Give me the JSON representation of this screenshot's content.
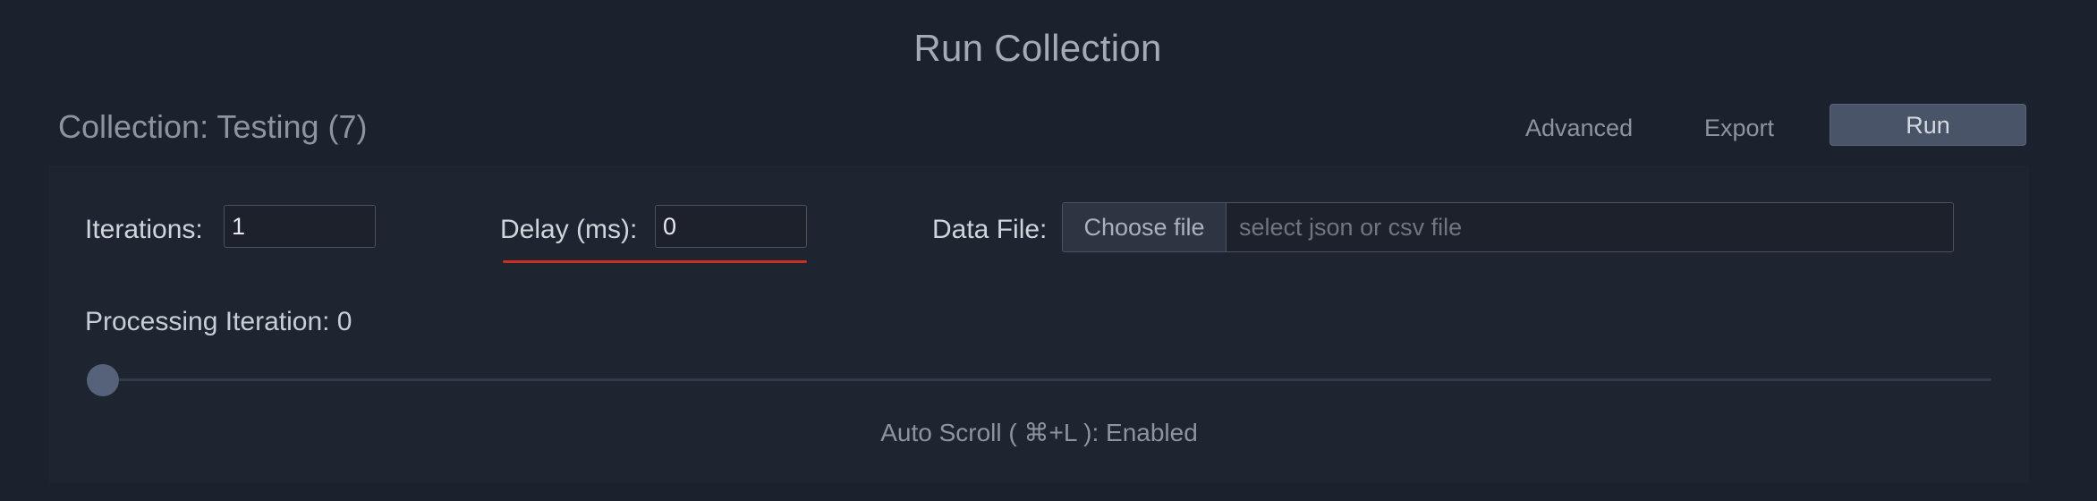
{
  "header": {
    "title": "Run Collection",
    "collection_name": "Collection: Testing (7)",
    "advanced_label": "Advanced",
    "export_label": "Export",
    "run_label": "Run"
  },
  "form": {
    "iterations_label": "Iterations:",
    "iterations_value": "1",
    "delay_label": "Delay (ms):",
    "delay_value": "0",
    "data_file_label": "Data File:",
    "choose_file_label": "Choose file",
    "data_file_placeholder": "select json or csv file"
  },
  "progress": {
    "processing_label": "Processing Iteration: 0",
    "slider_value": 0,
    "auto_scroll_text": "Auto Scroll ( ⌘+L ): Enabled"
  },
  "colors": {
    "background": "#1c222d",
    "panel": "#1f2530",
    "run_button": "#495468",
    "delay_underline": "#c9301f"
  }
}
